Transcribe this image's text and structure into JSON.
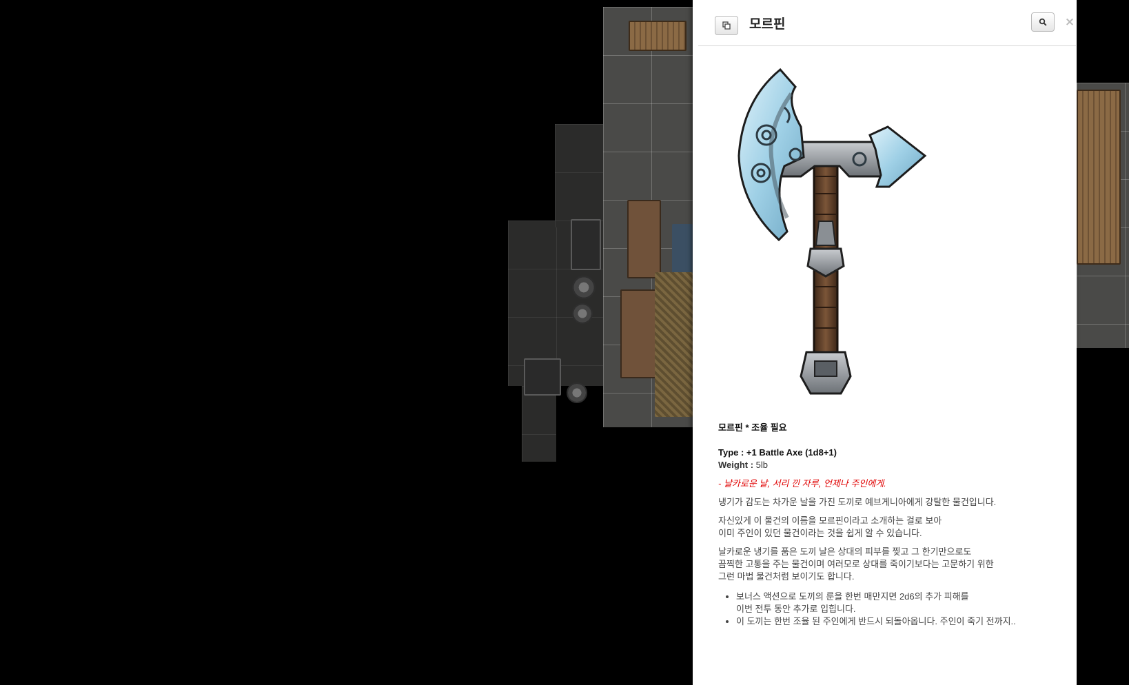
{
  "dialog": {
    "title": "모르핀",
    "icons": {
      "popout": "popout-icon",
      "search": "search-icon",
      "close": "close-icon"
    },
    "close_glyph": "×"
  },
  "item": {
    "heading": "모르핀 * 조율 필요",
    "type_line": "Type : +1 Battle Axe (1d8+1)",
    "weight_label": "Weight : ",
    "weight_value": "5lb",
    "motto": "- 날카로운 날, 서리 낀 자루, 언제나 주인에게.",
    "paragraphs": [
      "냉기가 감도는 차가운 날을 가진 도끼로 예브게니아에게 강탈한 물건입니다.",
      "자신있게 이 물건의 이름을 모르핀이라고 소개하는 걸로 보아\n이미 주인이 있던 물건이라는 것을 쉽게 알 수 있습니다.",
      "날카로운 냉기를 품은 도끼 날은 상대의 피부를 찢고 그 한기만으로도\n끔찍한 고통을 주는 물건이며 여러모로 상대를 죽이기보다는 고문하기 위한\n그런 마법 물건처럼 보이기도 합니다."
    ],
    "bullets": [
      "보너스 액션으로 도끼의 룬을 한번 매만지면 2d6의 추가 피해를\n이번 전투 동안 추가로 입힙니다.",
      "이 도끼는 한번 조율 된 주인에게 반드시 되돌아옵니다. 주인이 죽기 전까지.."
    ]
  },
  "colors": {
    "motto": "#e00000",
    "blade_ice": "#9fd0e6",
    "blade_steel": "#8a8f94",
    "haft_wood": "#6b4a32"
  }
}
